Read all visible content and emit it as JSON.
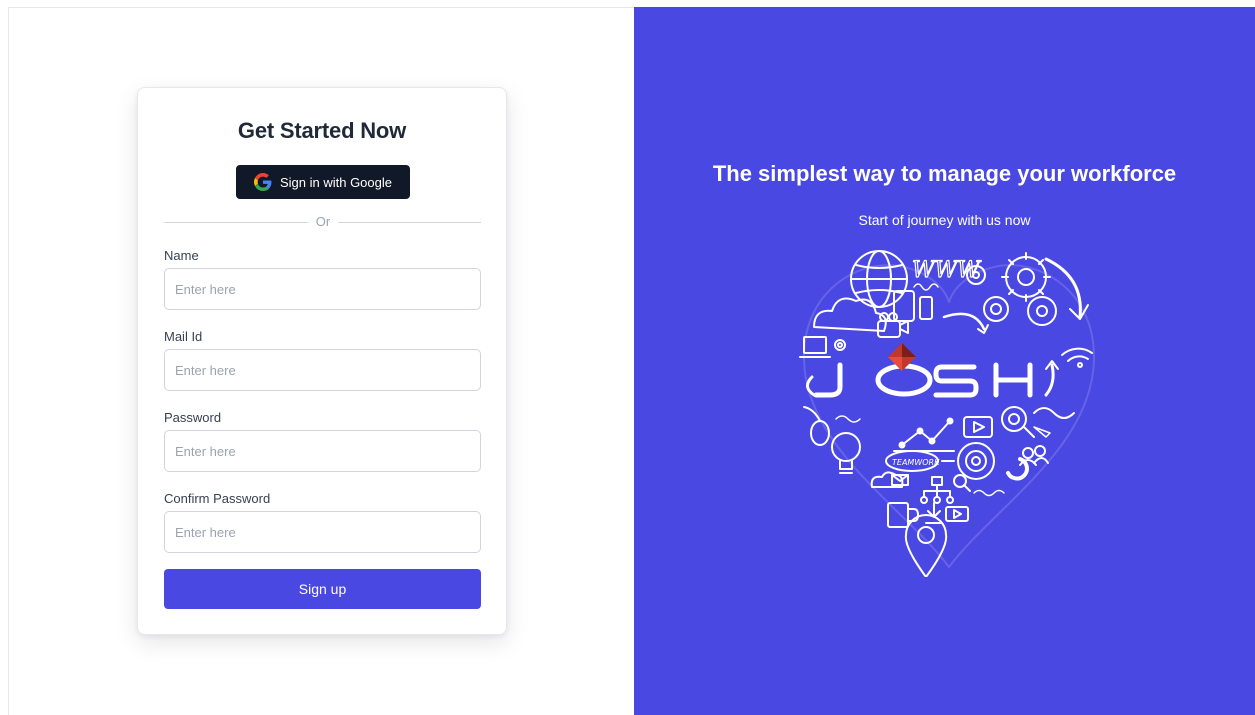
{
  "signup": {
    "title": "Get Started Now",
    "google_button_label": "Sign in with Google",
    "divider_text": "Or",
    "fields": [
      {
        "label": "Name",
        "placeholder": "Enter here",
        "value": ""
      },
      {
        "label": "Mail Id",
        "placeholder": "Enter here",
        "value": ""
      },
      {
        "label": "Password",
        "placeholder": "Enter here",
        "value": ""
      },
      {
        "label": "Confirm Password",
        "placeholder": "Enter here",
        "value": ""
      }
    ],
    "submit_label": "Sign up"
  },
  "hero": {
    "headline": "The simplest way to manage your workforce",
    "subheadline": "Start of journey with us now",
    "logo_text": "JOSH",
    "sketch_words": [
      "WWW",
      "TEAMWORK"
    ],
    "icons": [
      "globe-icon",
      "gear-icon",
      "cloud-icon",
      "camera-icon",
      "laptop-icon",
      "lightbulb-icon",
      "chart-icon",
      "video-play-icon",
      "magnifier-icon",
      "people-icon",
      "mug-icon",
      "location-pin-icon",
      "wifi-icon",
      "arrow-up-icon",
      "mouse-icon",
      "network-icon"
    ]
  },
  "colors": {
    "accent": "#4a48e2",
    "google_button_bg": "#111827",
    "logo_red": "#c0392b"
  }
}
